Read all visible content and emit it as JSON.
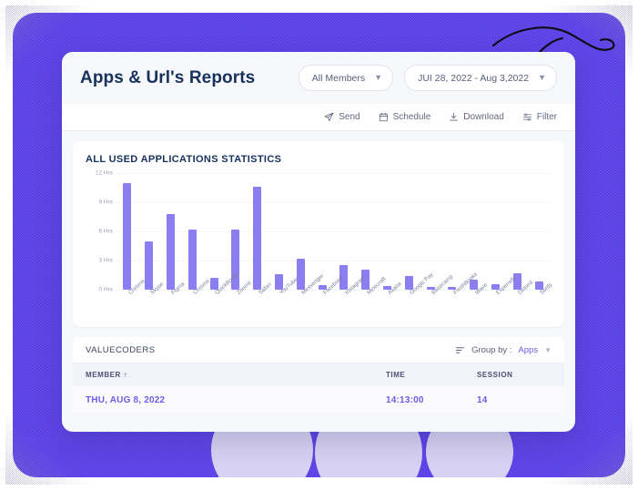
{
  "header": {
    "title": "Apps & Url's Reports",
    "members_filter": {
      "label": "All Members",
      "icon": "chevron-down-icon"
    },
    "date_range": {
      "label": "JUI 28, 2022 - Aug 3,2022",
      "icon": "chevron-down-icon"
    }
  },
  "toolbar": {
    "items": [
      {
        "label": "Send",
        "icon": "send-icon"
      },
      {
        "label": "Schedule",
        "icon": "calendar-icon"
      },
      {
        "label": "Download",
        "icon": "download-icon"
      },
      {
        "label": "Filter",
        "icon": "filter-icon"
      }
    ]
  },
  "chart_panel": {
    "title": "ALL USED APPLICATIONS STATISTICS"
  },
  "chart_data": {
    "type": "bar",
    "title": "ALL USED APPLICATIONS STATISTICS",
    "xlabel": "",
    "ylabel": "Hrs",
    "ylim": [
      0,
      12
    ],
    "yticks": [
      0,
      3,
      6,
      9,
      12
    ],
    "ytick_labels": [
      "0 Hrs",
      "3 Hrs",
      "6 Hrs",
      "9 Hrs",
      "12 Hrs"
    ],
    "grid": true,
    "legend": "none",
    "bar_color": "#8b7ef0",
    "categories": [
      "Chrome",
      "Skype",
      "Figma",
      "Chrome",
      "QuickBooks",
      "Zoomit",
      "Safari",
      "YouTube",
      "Messenger",
      "Facebook",
      "Instagram",
      "Minecraft",
      "Asana",
      "Google Pay",
      "Basecamp",
      "FreshBooks",
      "Wave",
      "Expensify",
      "Delivrd",
      "Sortly"
    ],
    "values": [
      11.0,
      5.0,
      7.8,
      6.2,
      1.2,
      6.2,
      10.6,
      1.6,
      3.2,
      0.5,
      2.5,
      2.1,
      0.35,
      1.4,
      0.3,
      0.3,
      1.0,
      0.6,
      1.7,
      0.8
    ]
  },
  "group_bar": {
    "organization": "VALUECODERS",
    "group_by_label": "Group by :",
    "group_by_value": "Apps",
    "icon": "group-lines-icon",
    "caret": "chevron-down-icon"
  },
  "table": {
    "columns": [
      "MEMBER",
      "TIME",
      "SESSION"
    ],
    "sort_indicator": "↑",
    "rows": [
      {
        "member": "THU, AUG 8, 2022",
        "time": "14:13:00",
        "session": "14"
      }
    ]
  },
  "colors": {
    "accent": "#6c5ce7",
    "frame": "#5c43e8",
    "bar": "#8b7ef0",
    "title": "#16315c",
    "blob": "#d7d2f4"
  }
}
